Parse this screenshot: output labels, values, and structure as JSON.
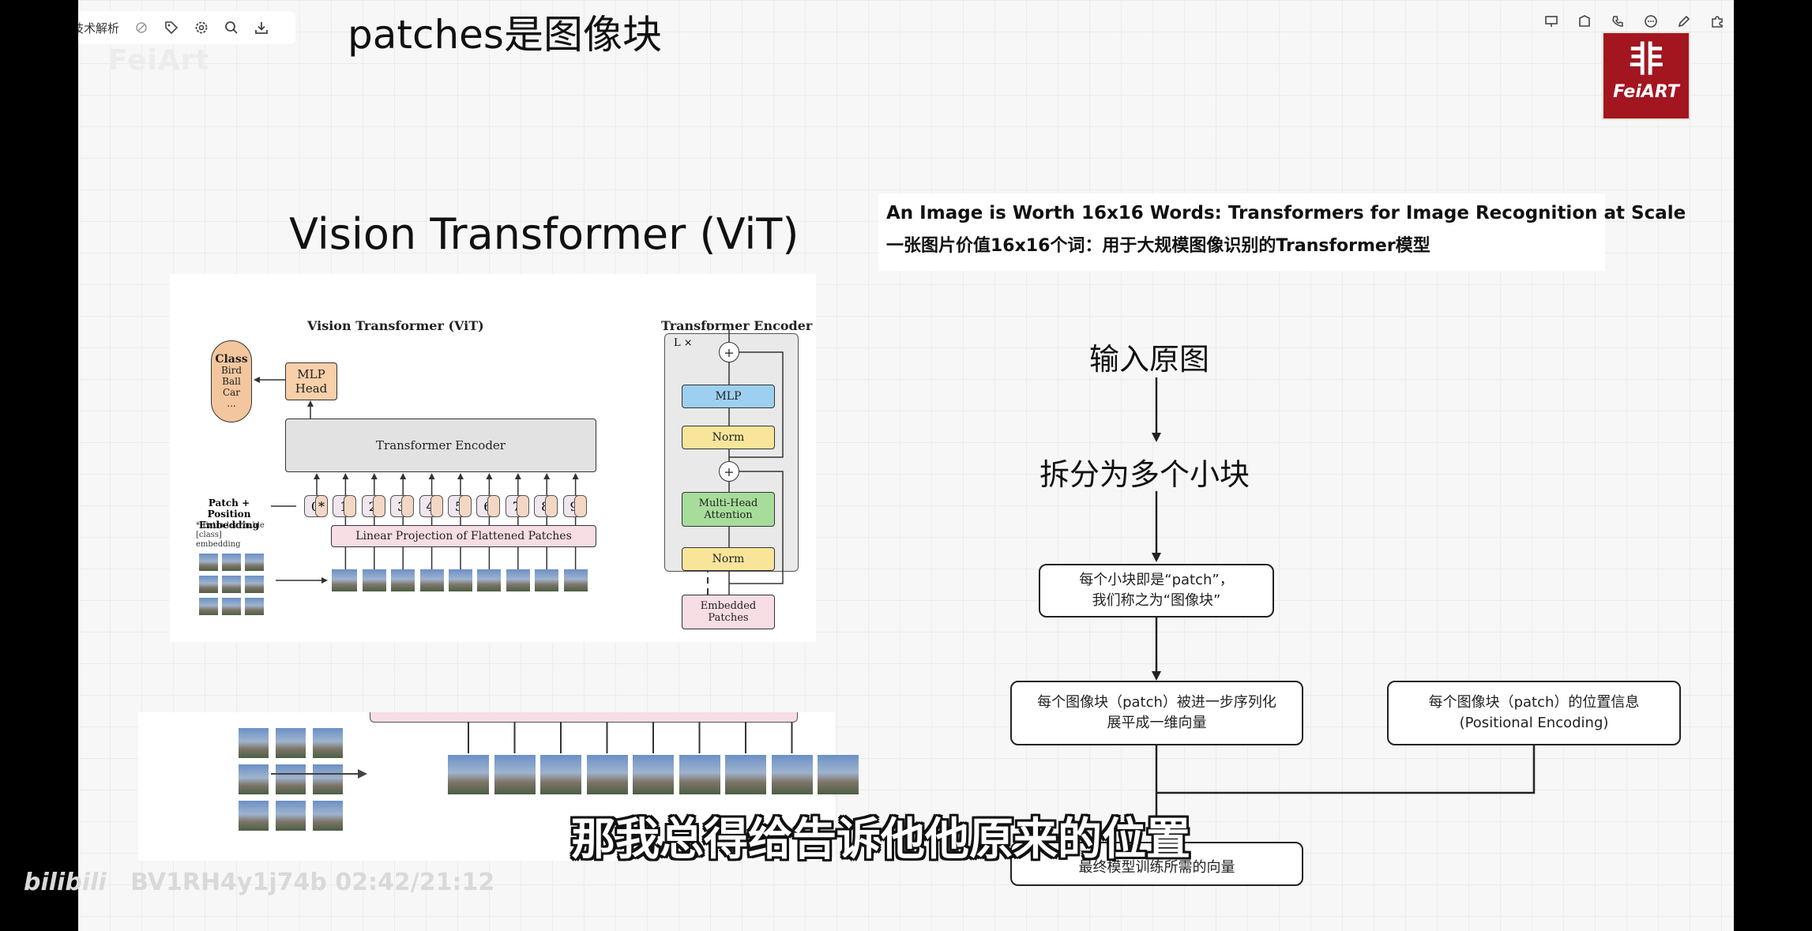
{
  "toolbar": {
    "doc_title": "技术解析",
    "left_icons": [
      "hide-icon",
      "tag-icon",
      "settings-icon",
      "search-icon",
      "download-icon"
    ],
    "right_icons": [
      "present-icon",
      "shape-icon",
      "link-icon",
      "comment-icon",
      "pen-icon",
      "puzzle-icon"
    ]
  },
  "slide": {
    "heading": "patches是图像块",
    "watermark": "FeiArt",
    "logo": {
      "char": "非",
      "text": "FeiART"
    }
  },
  "vit_figure": {
    "title": "Vision Transformer (ViT)",
    "left_title": "Vision Transformer (ViT)",
    "right_title": "Transformer Encoder",
    "class_box": {
      "head": "Class",
      "items": [
        "Bird",
        "Ball",
        "Car",
        "..."
      ]
    },
    "mlp_head": "MLP Head",
    "encoder_label": "Transformer Encoder",
    "patch_pos_label": "Patch + Position Embedding",
    "extra_note": "* Extra learnable [class] embedding",
    "linear_proj": "Linear Projection of Flattened Patches",
    "tokens": [
      "0*",
      "1",
      "2",
      "3",
      "4",
      "5",
      "6",
      "7",
      "8",
      "9"
    ],
    "enc_lx": "L ×",
    "enc_mlp": "MLP",
    "enc_norm": "Norm",
    "enc_attn": "Multi-Head Attention",
    "enc_embedded": "Embedded Patches",
    "enc_plus": "+"
  },
  "paper": {
    "title_en": "An Image is Worth 16x16 Words: Transformers for Image Recognition at Scale",
    "title_zh": "一张图片价值16x16个词：用于大规模图像识别的Transformer模型"
  },
  "flow": {
    "step1": "输入原图",
    "step2": "拆分为多个小块",
    "box1": "每个小块即是“patch”，\n我们称之为“图像块”",
    "box2": "每个图像块（patch）被进一步序列化\n展平成一维向量",
    "box3": "每个图像块（patch）的位置信息\n(Positional Encoding)",
    "box4": "最终模型训练所需的向量"
  },
  "subtitle": "那我总得给告诉他他原来的位置",
  "video_meta": {
    "brand": "bilibili",
    "id_time": "BV1RH4y1j74b 02:42/21:12"
  }
}
